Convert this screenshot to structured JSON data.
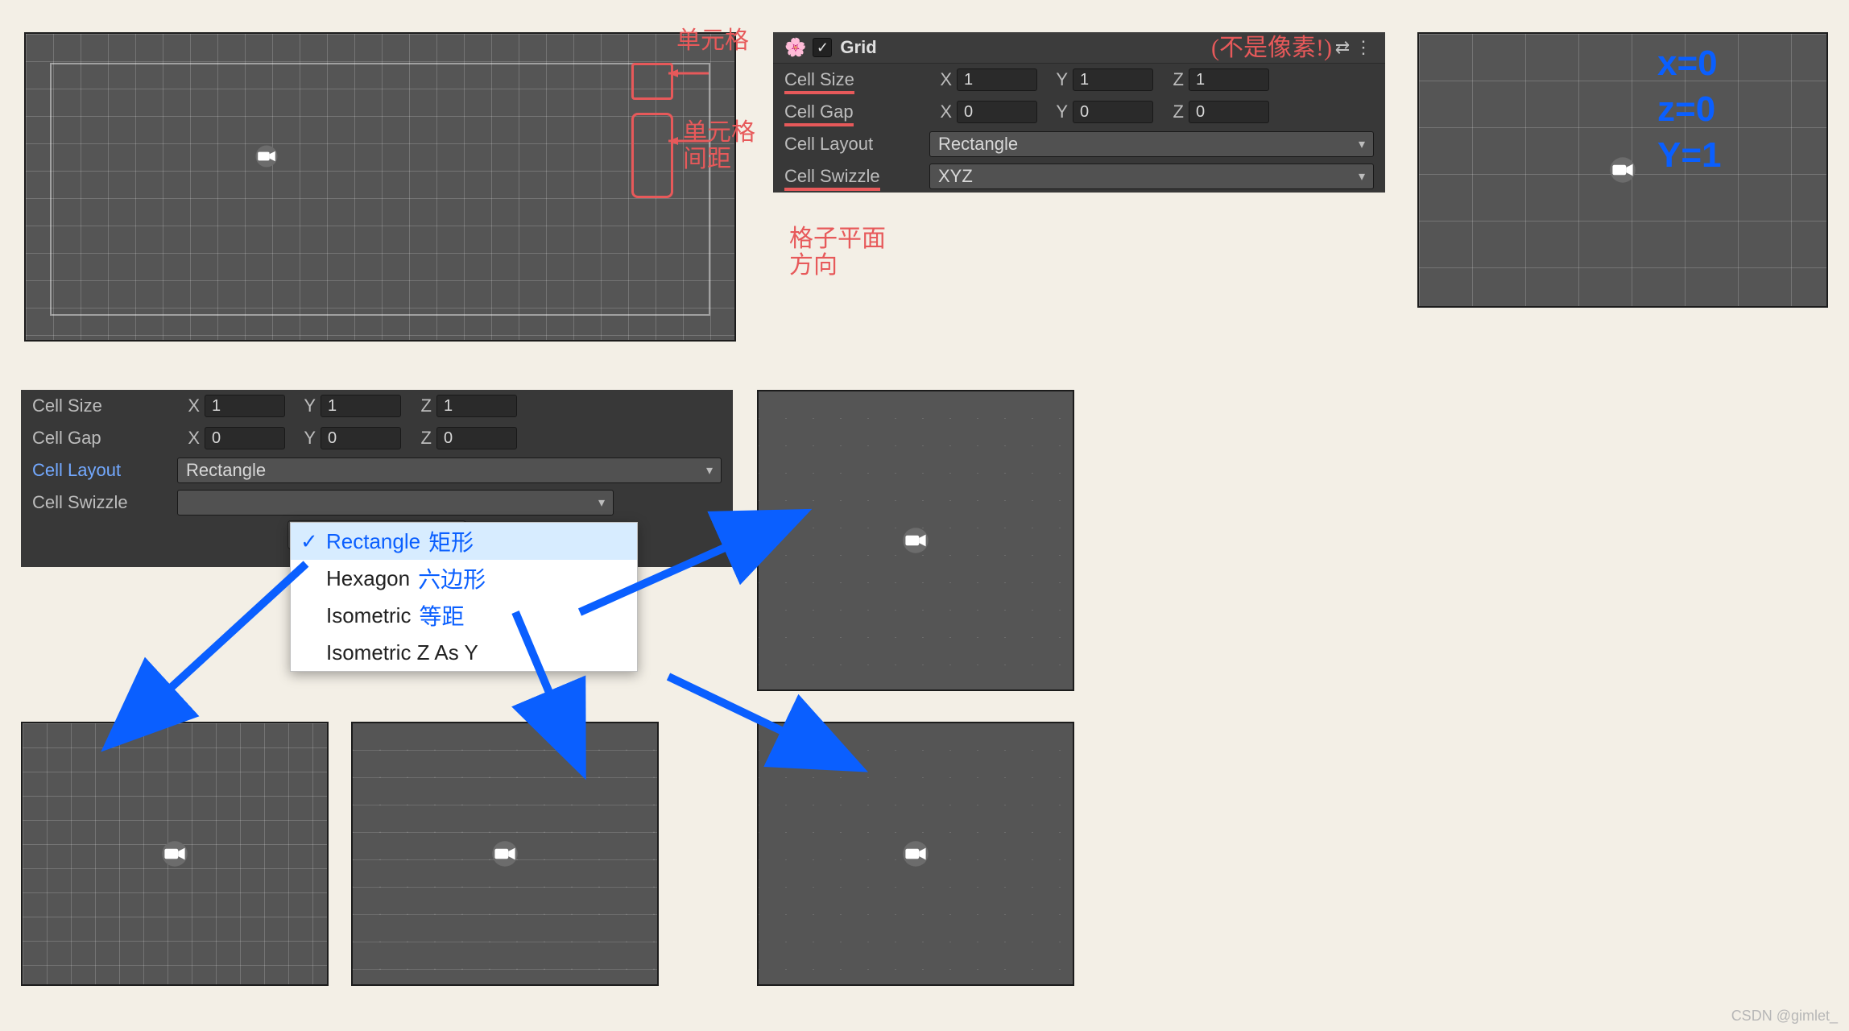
{
  "topInspector": {
    "component_title": "Grid",
    "enabled_checked": "✓",
    "flower_icon": "🌸",
    "cell_size_label": "Cell Size",
    "cell_gap_label": "Cell Gap",
    "cell_layout_label": "Cell Layout",
    "cell_swizzle_label": "Cell Swizzle",
    "x_label": "X",
    "y_label": "Y",
    "z_label": "Z",
    "cell_size_x": "1",
    "cell_size_y": "1",
    "cell_size_z": "1",
    "cell_gap_x": "0",
    "cell_gap_y": "0",
    "cell_gap_z": "0",
    "cell_layout_value": "Rectangle",
    "cell_swizzle_value": "XYZ"
  },
  "redNotes": {
    "title_note": "(不是像素!)",
    "box1_label": "单元格",
    "box2_label1": "单元格",
    "box2_label2": "间距",
    "swizzle_label1": "格子平面",
    "swizzle_label2": "方向"
  },
  "rightScene": {
    "blue_line1": "x=0",
    "blue_line2": "z=0",
    "blue_line3": "Y=1"
  },
  "secondInspector": {
    "cell_size_label": "Cell Size",
    "cell_gap_label": "Cell Gap",
    "cell_layout_label": "Cell Layout",
    "cell_swizzle_label": "Cell Swizzle",
    "x_label": "X",
    "y_label": "Y",
    "z_label": "Z",
    "cell_size_x": "1",
    "cell_size_y": "1",
    "cell_size_z": "1",
    "cell_gap_x": "0",
    "cell_gap_y": "0",
    "cell_gap_z": "0",
    "cell_layout_value": "Rectangle",
    "cell_swizzle_placeholder": ""
  },
  "layoutMenu": {
    "items": [
      {
        "label": "Rectangle",
        "cn": "矩形",
        "selected": true
      },
      {
        "label": "Hexagon",
        "cn": "六边形",
        "selected": false
      },
      {
        "label": "Isometric",
        "cn": "等距",
        "selected": false
      },
      {
        "label": "Isometric Z As Y",
        "cn": "",
        "selected": false
      }
    ]
  },
  "watermark": "CSDN @gimlet_"
}
